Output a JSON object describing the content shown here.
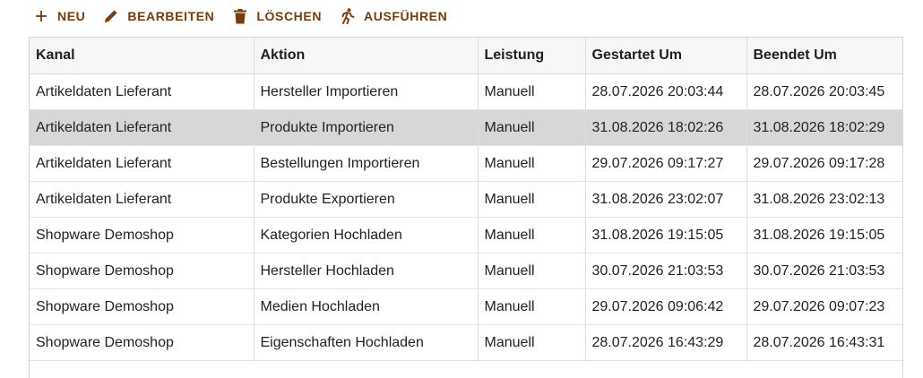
{
  "toolbar": {
    "new_label": "NEU",
    "edit_label": "BEARBEITEN",
    "delete_label": "LÖSCHEN",
    "run_label": "AUSFÜHREN",
    "icons": [
      "plus-icon",
      "pencil-icon",
      "trash-icon",
      "running-person-icon"
    ],
    "accent_color": "#7a3b0a"
  },
  "table": {
    "headers": {
      "kanal": "Kanal",
      "aktion": "Aktion",
      "leistung": "Leistung",
      "gestartet": "Gestartet Um",
      "beendet": "Beendet Um"
    },
    "selected_row_index": 1,
    "selected_row_color": "#d7d7d7",
    "rows": [
      {
        "kanal": "Artikeldaten Lieferant",
        "aktion": "Hersteller Importieren",
        "leistung": "Manuell",
        "gestartet": "28.07.2026 20:03:44",
        "beendet": "28.07.2026 20:03:45"
      },
      {
        "kanal": "Artikeldaten Lieferant",
        "aktion": "Produkte Importieren",
        "leistung": "Manuell",
        "gestartet": "31.08.2026 18:02:26",
        "beendet": "31.08.2026 18:02:29"
      },
      {
        "kanal": "Artikeldaten Lieferant",
        "aktion": "Bestellungen Importieren",
        "leistung": "Manuell",
        "gestartet": "29.07.2026 09:17:27",
        "beendet": "29.07.2026 09:17:28"
      },
      {
        "kanal": "Artikeldaten Lieferant",
        "aktion": "Produkte Exportieren",
        "leistung": "Manuell",
        "gestartet": "31.08.2026 23:02:07",
        "beendet": "31.08.2026 23:02:13"
      },
      {
        "kanal": "Shopware Demoshop",
        "aktion": "Kategorien Hochladen",
        "leistung": "Manuell",
        "gestartet": "31.08.2026 19:15:05",
        "beendet": "31.08.2026 19:15:05"
      },
      {
        "kanal": "Shopware Demoshop",
        "aktion": "Hersteller Hochladen",
        "leistung": "Manuell",
        "gestartet": "30.07.2026 21:03:53",
        "beendet": "30.07.2026 21:03:53"
      },
      {
        "kanal": "Shopware Demoshop",
        "aktion": "Medien Hochladen",
        "leistung": "Manuell",
        "gestartet": "29.07.2026 09:06:42",
        "beendet": "29.07.2026 09:07:23"
      },
      {
        "kanal": "Shopware Demoshop",
        "aktion": "Eigenschaften Hochladen",
        "leistung": "Manuell",
        "gestartet": "28.07.2026 16:43:29",
        "beendet": "28.07.2026 16:43:31"
      }
    ]
  }
}
